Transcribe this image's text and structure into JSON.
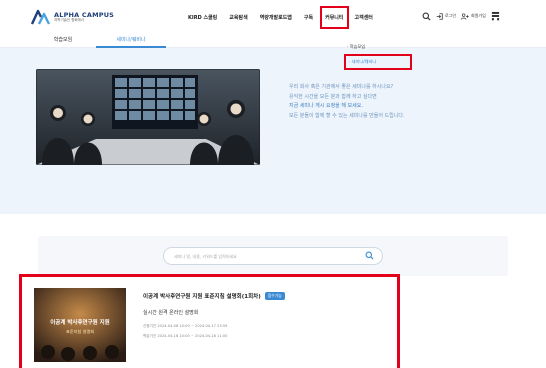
{
  "logo": {
    "title": "ALPHA CAMPUS",
    "subtitle": "과학기술인 협회에서",
    "colors": [
      "#1f3f7a",
      "#4aa3df"
    ]
  },
  "nav": {
    "items": [
      {
        "label": "KIRD 스쿨링"
      },
      {
        "label": "교육탐색"
      },
      {
        "label": "역량개발로드맵"
      },
      {
        "label": "구독"
      },
      {
        "label": "커뮤니티",
        "highlighted": true
      },
      {
        "label": "고객센터"
      }
    ]
  },
  "utility": {
    "search_icon": "search-icon",
    "login_label": "로그인",
    "join_label": "회원가입",
    "menu_icon": "sitemap-icon"
  },
  "subnav": {
    "tabs": [
      {
        "label": "학습모임"
      },
      {
        "label": "세미나/웨비나",
        "active": true
      }
    ]
  },
  "dropdown": {
    "items": [
      {
        "label": "학습모임"
      },
      {
        "label": "세미나/웨비나",
        "highlighted": true
      }
    ]
  },
  "hero": {
    "lines": [
      {
        "text": "우리 회사 혹은 기관에서 좋은 세미나를 하시나요?"
      },
      {
        "text": "유익한 시간을 모든 분과 함께 하고 싶다면"
      },
      {
        "text": "지금 세미나 게시 요청을 해 보세요.",
        "emphasis": true
      },
      {
        "text": "모든 분들이 함께 할 수 있는 세미나를 만들어 드립니다."
      }
    ]
  },
  "search": {
    "placeholder": "세미나 명, 내용, 키워드를 입력하세요"
  },
  "card": {
    "title": "이공계 박사후연구원 지원 표준지침 설명회(1회차)",
    "badge": "접수가능",
    "subtitle": "실시간 원격 온라인 설명회",
    "meta": [
      "신청기간 2024-04-08 10:00 ~ 2024-04-17 23:59",
      "학습기간 2024-04-18 10:00 ~ 2024-04-18 11:00"
    ],
    "thumb_title": "이공계 박사후연구원 지원",
    "thumb_sub": "표준지침 설명회"
  },
  "colors": {
    "accent": "#3a8ad3",
    "highlight": "#e2001a",
    "hero_bg": "#eef4fb"
  }
}
